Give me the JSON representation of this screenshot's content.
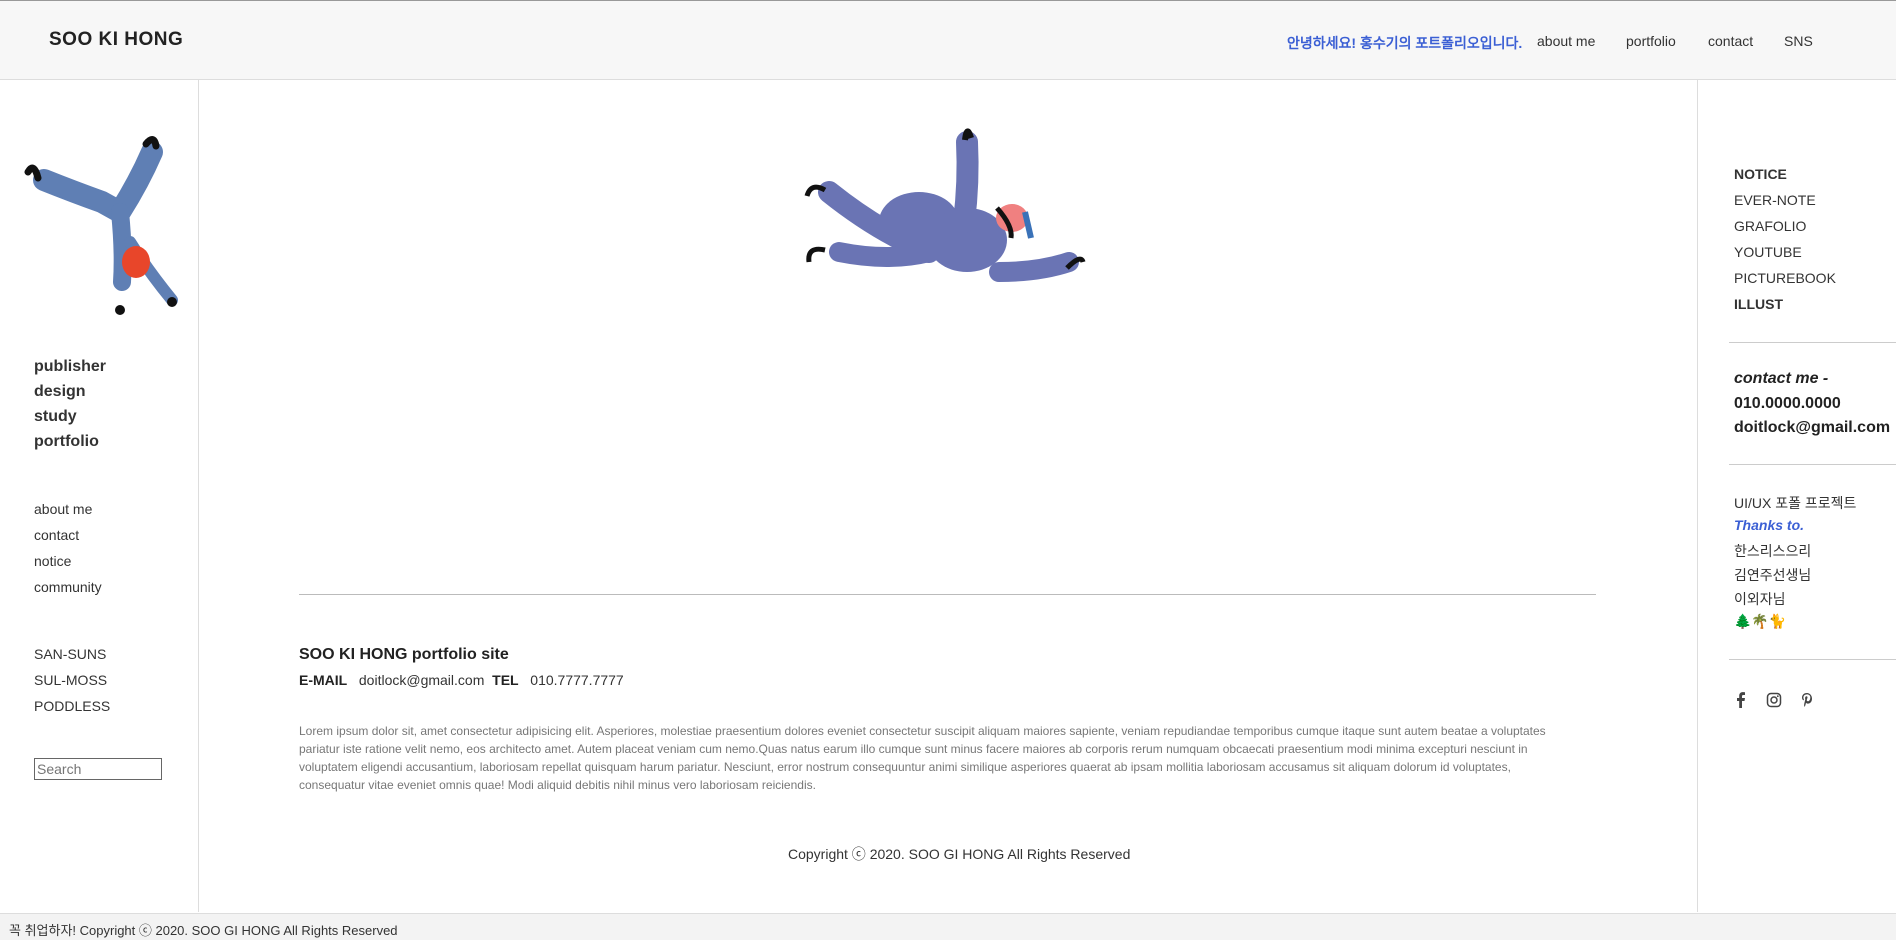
{
  "header": {
    "brand": "SOO KI HONG",
    "greeting": "안녕하세요! 홍수기의 포트폴리오입니다.",
    "nav": [
      "about me",
      "portfolio",
      "contact",
      "SNS"
    ]
  },
  "left": {
    "categories": [
      "publisher",
      "design",
      "study",
      "portfolio"
    ],
    "links": [
      "about me",
      "contact",
      "notice",
      "community"
    ],
    "projects": [
      "SAN-SUNS",
      "SUL-MOSS",
      "PODDLESS"
    ],
    "search_placeholder": "Search"
  },
  "right": {
    "links": [
      "NOTICE",
      "EVER-NOTE",
      "GRAFOLIO",
      "YOUTUBE",
      "PICTUREBOOK",
      "ILLUST"
    ],
    "contact_label": "contact me -",
    "contact_phone": "010.0000.0000",
    "contact_email": "doitlock@gmail.com",
    "project": "UI/UX 포폴 프로젝트",
    "thanks_label": "Thanks to.",
    "thanks": [
      "한스리스으리",
      "김연주선생님",
      "이외자님"
    ],
    "emoji": "🌲🌴🐈",
    "social_icons": [
      "facebook-icon",
      "instagram-icon",
      "pinterest-icon"
    ]
  },
  "main": {
    "footer_title": "SOO KI HONG portfolio site",
    "email_label": "E-MAIL",
    "email": "doitlock@gmail.com",
    "tel_label": "TEL",
    "tel": "010.7777.7777",
    "lorem": "Lorem ipsum dolor sit, amet consectetur adipisicing elit. Asperiores, molestiae praesentium dolores eveniet consectetur suscipit aliquam maiores sapiente, veniam repudiandae temporibus cumque itaque sunt autem beatae a voluptates pariatur iste ratione velit nemo, eos architecto amet. Autem placeat veniam cum nemo.Quas natus earum illo cumque sunt minus facere maiores ab corporis rerum numquam obcaecati praesentium modi minima excepturi nesciunt in voluptatem eligendi accusantium, laboriosam repellat quisquam harum pariatur. Nesciunt, error nostrum consequuntur animi similique asperiores quaerat ab ipsam mollitia laboriosam accusamus sit aliquam dolorum id voluptates, consequatur vitae eveniet omnis quae! Modi aliquid debitis nihil minus vero laboriosam reiciendis.",
    "copyright": "Copyright ⓒ 2020. SOO GI HONG All Rights Reserved"
  },
  "bottombar": {
    "text": "꼭 취업하자! Copyright ⓒ 2020. SOO GI HONG All Rights Reserved"
  }
}
